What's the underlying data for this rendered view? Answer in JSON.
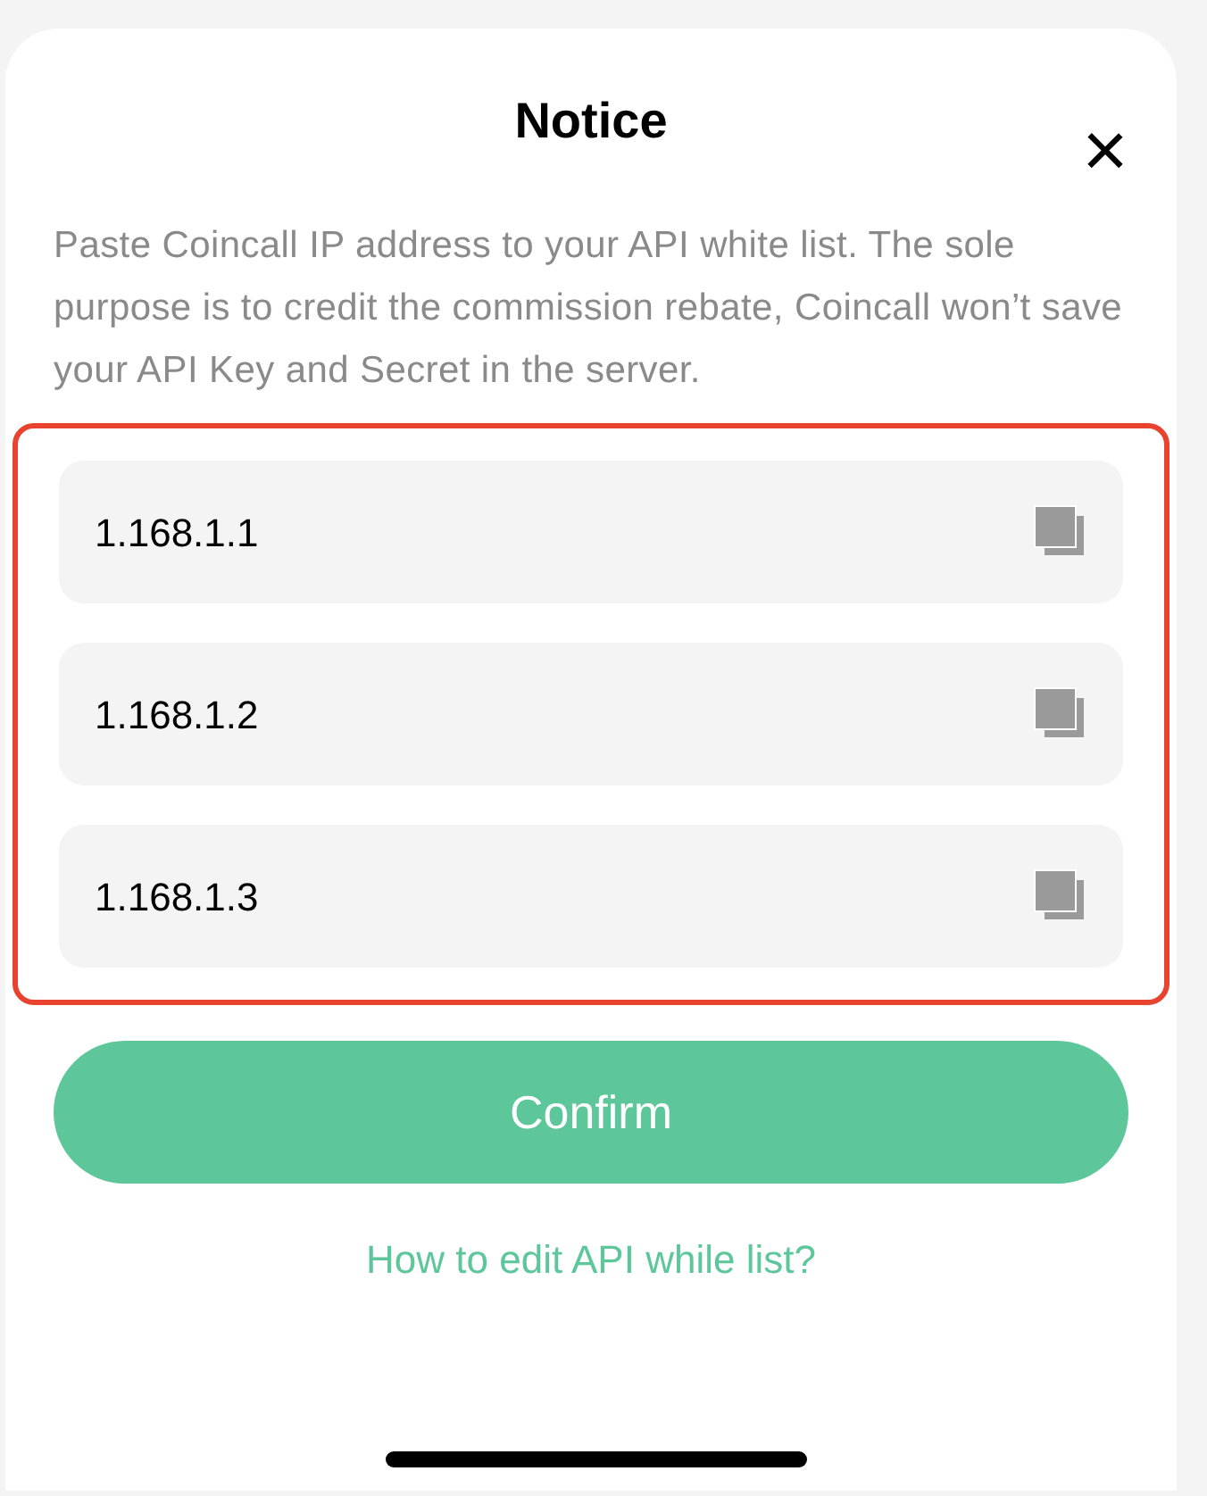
{
  "dialog": {
    "title": "Notice",
    "close": "×",
    "message": "Paste Coincall IP address to your API white list. The sole purpose is to credit the commission rebate, Coincall won’t save your API Key and Secret in the server."
  },
  "ip_addresses": [
    {
      "value": "1.168.1.1"
    },
    {
      "value": "1.168.1.2"
    },
    {
      "value": "1.168.1.3"
    }
  ],
  "confirm_button": "Confirm",
  "help_link": "How to edit API while list?"
}
